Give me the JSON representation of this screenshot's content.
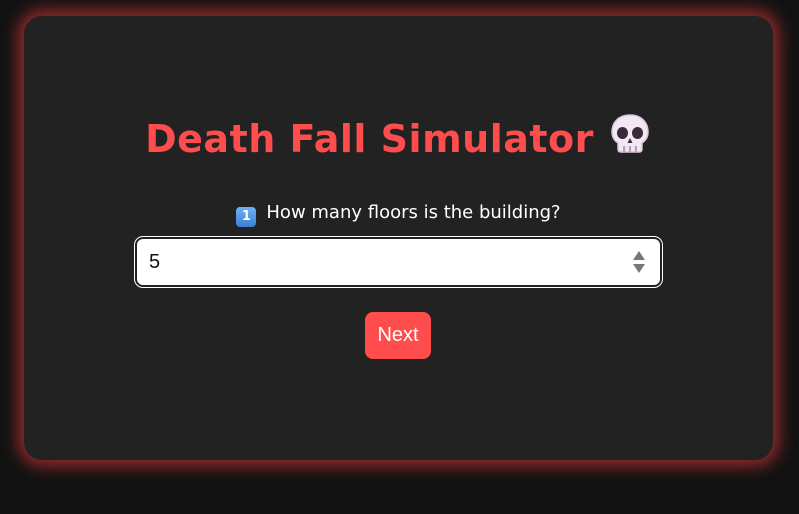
{
  "app": {
    "title": "Death Fall Simulator",
    "title_icon": "skull-icon",
    "accent_color": "#ff4d4d"
  },
  "question": {
    "step_badge": "1",
    "step_icon": "keycap-one-icon",
    "text": "How many floors is the building?"
  },
  "floors_input": {
    "value": "5",
    "spinner_icon": "spinner-arrows-icon"
  },
  "actions": {
    "next_label": "Next"
  }
}
